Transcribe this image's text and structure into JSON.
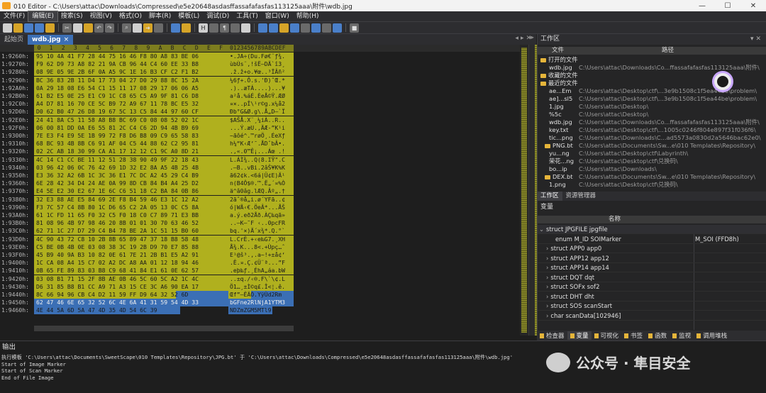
{
  "window": {
    "title": "010 Editor - C:\\Users\\attac\\Downloads\\Compressed\\e5e20648asdasffassafafasfas113125aaa\\附件\\wdb.jpg"
  },
  "menu": [
    "文件(F)",
    "编辑(E)",
    "搜索(S)",
    "视图(V)",
    "格式(O)",
    "脚本(R)",
    "模板(L)",
    "调试(D)",
    "工具(T)",
    "窗口(W)",
    "帮助(H)"
  ],
  "tabs": {
    "start": "起始页",
    "file": "wdb.jpg",
    "close": "×"
  },
  "hex": {
    "column_labels": [
      "0",
      "1",
      "2",
      "3",
      "4",
      "5",
      "6",
      "7",
      "8",
      "9",
      "A",
      "B",
      "C",
      "D",
      "E",
      "F"
    ],
    "ascii_header": "0123456789ABCDEF",
    "rows": [
      {
        "addr": "1:9260h:",
        "hex": "95 10 4A 41 F7 28 44 75 16 46 F8 80 A8 83 BE 06",
        "ascii": "•.JA÷(Du.Fø€¨ƒ¾."
      },
      {
        "addr": "1:9270h:",
        "hex": "F9 62 D9 73 A8 82 21 9A CB 96 44 C4 60 EE 33 B8",
        "ascii": "ùbÙs¨‚!šË–DÄ`î3¸"
      },
      {
        "addr": "1:9280h:",
        "hex": "08 9E 05 9E 2B 6F 0A A5 9C 1E 16 B3 CF C2 F1 B2",
        "ascii": ".ž.ž+o.¥œ..³ÏÂñ²"
      },
      {
        "addr": "1:9290h:",
        "hex": "BC 36 83 2B 11 D4 17 73 04 27 D0 29 88 8C 15 2A",
        "ascii": "¼6ƒ+.Ô.s.'Ð)ˆŒ.*"
      },
      {
        "addr": "1:92A0h:",
        "hex": "0A 29 18 08 E6 54 C1 15 11 17 08 29 17 06 06 A5",
        "ascii": ".)..æTÁ....)...¥"
      },
      {
        "addr": "1:92B0h:",
        "hex": "61 B2 E5 0E 25 E1 C9 1C C8 65 C5 A9 9F 81 C6 D8",
        "ascii": "a²å.%áÉ.ÈeÅ©Ÿ.ÆØ"
      },
      {
        "addr": "1:92C0h:",
        "hex": "A4 D7 81 16 70 CE 5C B9 72 A9 67 11 78 BC E5 32",
        "ascii": "¤×..pÎ\\¹r©g.x¼å2"
      },
      {
        "addr": "1:92D0h:",
        "hex": "D0 62 B0 47 26 D8 19 67 5C 13 C5 84 44 97 60 CF",
        "ascii": "Ðb°G&Ø.g\\.Å„D—`Ï"
      },
      {
        "addr": "1:92E0h:",
        "hex": "24 41 8A C5 11 58 A8 B8 BC 69 C0 08 08 52 02 1C",
        "ascii": "$AŠÅ.X¨¸¼iÀ..R.."
      },
      {
        "addr": "1:92F0h:",
        "hex": "06 00 81 DD 0A E6 55 81 2C C4 C6 2D 94 4B B9 69",
        "ascii": "...Ý.æU.,ÄÆ-”K¹i"
      },
      {
        "addr": "1:9300h:",
        "hex": "7E E3 F4 E9 5E 1B 99 72 F8 D6 B8 09 C9 65 58 83",
        "ascii": "~ãôé^.™røÖ¸.ÉeXƒ"
      },
      {
        "addr": "1:9310h:",
        "hex": "68 BC 93 4B 8B C6 91 AF 04 C5 44 88 62 C2 95 81",
        "ascii": "h¼“K‹Æ‘¯.ÅDˆbÂ•."
      },
      {
        "addr": "1:9320h:",
        "hex": "02 2C AB 18 30 99 CA A1 17 12 12 C1 9C A0 8D 21",
        "ascii": ".,«.0™Ê¡...Áœ .!"
      },
      {
        "addr": "1:9330h:",
        "hex": "4C 14 C1 CC BE 11 12 51 28 38 90 49 9F 22 18 43",
        "ascii": "L.ÁÌ¾..Q(8.IŸ\".C"
      },
      {
        "addr": "1:9340h:",
        "hex": "03 96 42 06 0C 76 42 69 1D 32 E2 8A A5 4B 25 4B",
        "ascii": ".–B..vBi.2âŠ¥K%K"
      },
      {
        "addr": "1:9350h:",
        "hex": "E3 36 32 A2 6B 1C 3C 36 E1 7C DC A2 45 29 C4 B9",
        "ascii": "ã62¢k.<6á|Ü¢E)Ä¹"
      },
      {
        "addr": "1:9360h:",
        "hex": "6E 28 42 34 D4 24 AE 0A 99 8D CB 84 B4 A4 25 D2",
        "ascii": "n(B4Ô$®.™.Ë„´¤%Ò"
      },
      {
        "addr": "1:9370h:",
        "hex": "E4 5E E2 30 E2 67 1E 6C C6 51 18 C2 BA 84 0B 86",
        "ascii": "ä^â0âg.lÆQ.Âº„.†"
      },
      {
        "addr": "1:9380h:",
        "hex": "32 E3 88 AE E5 84 69 2E F8 B4 59 46 E3 1C 12 A2",
        "ascii": "2ãˆ®å„i.ø´YFã..¢"
      },
      {
        "addr": "1:9390h:",
        "hex": "F3 7C 57 C4 8B 80 1C D6 65 C2 2A 05 13 0C C5 8A",
        "ascii": "ó|WÄ‹€.ÖeÂ*...ÅŠ"
      },
      {
        "addr": "1:93A0h:",
        "hex": "61 1C FD 11 65 F0 32 C5 F0 18 C0 C7 89 71 E3 BB",
        "ascii": "a.ý.eð2Åð.ÀÇ‰qã»"
      },
      {
        "addr": "1:93B0h:",
        "hex": "81 08 96 4B 97 98 46 20 8B 01 01 30 70 63 46 52",
        "ascii": "..–K—˜F ‹..0pcFR"
      },
      {
        "addr": "1:93C0h:",
        "hex": "62 71 1C 27 D7 29 C4 B4 78 BE 2A 1C 51 15 B0 60",
        "ascii": "bq.'×)Ä´x¾*.Q.°`"
      },
      {
        "addr": "1:93D0h:",
        "hex": "4C 90 43 72 C8 10 2B 8B 65 89 47 37 18 B8 58 48",
        "ascii": "L.CrÈ.+‹e‰G7.¸XH"
      },
      {
        "addr": "1:93E0h:",
        "hex": "C5 BE 0B 4B 0E 03 08 38 3C 19 2B D9 70 E7 85 88",
        "ascii": "Å¾.K...8<.+Ùpç…ˆ"
      },
      {
        "addr": "1:93F0h:",
        "hex": "45 B9 40 9A B3 10 82 0E 61 7E 21 2B B1 E5 A2 91",
        "ascii": "E¹@š³.‚.a~!+±å¢‘"
      },
      {
        "addr": "1:9400h:",
        "hex": "1C CA 08 A4 15 C7 02 A2 DC A8 AA 01 12 18 94 46",
        "ascii": ".Ê.¤.Ç.¢Ü¨ª...”F"
      },
      {
        "addr": "1:9410h:",
        "hex": "0B 65 FE 89 83 03 B8 C9 68 41 84 E1 61 0E 62 57",
        "ascii": ".eþ‰ƒ.¸ÉhA„áa.bW"
      },
      {
        "addr": "1:9420h:",
        "hex": "03 08 B1 71 15 2F 8B AE 0B 46 5C 60 5C A2 1C 4C",
        "ascii": "..±q./‹®.F\\`\\¢.L"
      },
      {
        "addr": "1:9430h:",
        "hex": "D6 31 85 B8 B1 CC A9 71 A3 15 CE 3C A6 90 EA 17",
        "ascii": "Ö1…¸±Ì©q£.Î<¦.ê."
      },
      {
        "addr": "1:9440h:",
        "hex": "8C 66 94 96 CB C4 D2 11 59 FF D9 64 32 52 6D",
        "ascii": "Œf”–ËÄÒ.YÿÙd2Rm"
      },
      {
        "addr": "1:9450h:",
        "hex": "62 47 46 6E 65 32 52 6C 4E 6A 41 31 59 54 4D 33",
        "ascii": "bGFne2RlNjA1YTM3"
      },
      {
        "addr": "1:9460h:",
        "hex": "4E 44 5A 6D 5A 47 4D 35 4D 54 6C 39",
        "ascii": "NDZmZGM5MTl9"
      }
    ]
  },
  "workspace": {
    "title": "工作区",
    "col_file": "文件",
    "col_path": "路径",
    "items": [
      {
        "indent": 0,
        "folder": true,
        "name": "打开的文件",
        "path": ""
      },
      {
        "indent": 2,
        "folder": false,
        "name": "wdb.jpg",
        "path": "C:\\Users\\attac\\Downloads\\Co...ffassafafasfas113125aaa\\附件\\"
      },
      {
        "indent": 0,
        "folder": true,
        "name": "收藏的文件",
        "path": ""
      },
      {
        "indent": 0,
        "folder": true,
        "name": "最近的文件",
        "path": ""
      },
      {
        "indent": 2,
        "folder": false,
        "name": "ae...Em",
        "path": "C:\\Users\\attac\\Desktop\\ctf\\...3e9b1508c1f5ea44be\\problem\\"
      },
      {
        "indent": 2,
        "folder": false,
        "name": "ae]...sl5",
        "path": "C:\\Users\\attac\\Desktop\\ctf\\...3e9b1508c1f5ea44be\\problem\\"
      },
      {
        "indent": 2,
        "folder": false,
        "name": "1.jpg",
        "path": "C:\\Users\\attac\\Desktop\\"
      },
      {
        "indent": 2,
        "folder": false,
        "name": "%5c",
        "path": "C:\\Users\\attac\\Desktop\\"
      },
      {
        "indent": 2,
        "folder": false,
        "name": "wdb.jpg",
        "path": "C:\\Users\\attac\\Downloads\\Co...ffassafafasfas113125aaa\\附件\\"
      },
      {
        "indent": 2,
        "folder": false,
        "name": "key.txt",
        "path": "C:\\Users\\attac\\Desktop\\ctf\\...1005c0246f804e897f31f036f6\\"
      },
      {
        "indent": 2,
        "folder": false,
        "name": "tic...png",
        "path": "C:\\Users\\attac\\Downloads\\C...ad5573a0830d2a5646bac62e0\\"
      },
      {
        "indent": 1,
        "folder": true,
        "name": "PNG.bt",
        "path": "C:\\Users\\attac\\Documents\\Sw...e\\010 Templates\\Repository\\"
      },
      {
        "indent": 2,
        "folder": false,
        "name": "yu...ng",
        "path": "C:\\Users\\attac\\Desktop\\ctf\\Labyrinth\\"
      },
      {
        "indent": 2,
        "folder": false,
        "name": "荣花...ng",
        "path": "C:\\Users\\attac\\Desktop\\ctf\\兑换码\\"
      },
      {
        "indent": 2,
        "folder": false,
        "name": "bo...ip",
        "path": "C:\\Users\\attac\\Downloads\\"
      },
      {
        "indent": 1,
        "folder": true,
        "name": "DEX.bt",
        "path": "C:\\Users\\attac\\Documents\\Sw...e\\010 Templates\\Repository\\"
      },
      {
        "indent": 2,
        "folder": false,
        "name": "1.png",
        "path": "C:\\Users\\attac\\Desktop\\ctf\\兑换码\\"
      }
    ],
    "tabs": [
      "工作区",
      "资源管理器"
    ]
  },
  "variables": {
    "title": "变量",
    "col_name": "名称",
    "items": [
      {
        "indent": 0,
        "name": "struct JPGFILE jpgfile",
        "value": "",
        "root": true,
        "arrow": "⌄"
      },
      {
        "indent": 2,
        "name": "enum M_ID SOIMarker",
        "value": "M_SOI (FFD8h)",
        "arrow": ""
      },
      {
        "indent": 1,
        "name": "struct APP0 app0",
        "value": "",
        "arrow": "›"
      },
      {
        "indent": 1,
        "name": "struct APP12 app12",
        "value": "",
        "arrow": "›"
      },
      {
        "indent": 1,
        "name": "struct APP14 app14",
        "value": "",
        "arrow": "›"
      },
      {
        "indent": 1,
        "name": "struct DQT dqt",
        "value": "",
        "arrow": "›"
      },
      {
        "indent": 1,
        "name": "struct SOFx sof2",
        "value": "",
        "arrow": "›"
      },
      {
        "indent": 1,
        "name": "struct DHT dht",
        "value": "",
        "arrow": "›"
      },
      {
        "indent": 1,
        "name": "struct SOS scanStart",
        "value": "",
        "arrow": "›"
      },
      {
        "indent": 1,
        "name": "char scanData[102946]",
        "value": "",
        "arrow": "›"
      }
    ]
  },
  "bottom_tabs": [
    "检查器",
    "变量",
    "可视化",
    "书签",
    "函数",
    "监视",
    "调用堆栈"
  ],
  "output": {
    "title": "输出",
    "lines": [
      "执行模板 'C:\\Users\\attac\\Documents\\SweetScape\\010 Templates\\Repository\\JPG.bt' 于 'C:\\Users\\attac\\Downloads\\Compressed\\e5e20648asdasffassafafasfas113125aaa\\附件\\wdb.jpg'",
      "Start of Image Marker",
      "Start of Scan Marker",
      "End of File Image"
    ]
  },
  "watermark": "公众号 · 隼目安全",
  "colors": {
    "hex_bg": "#b0b01e",
    "selection": "#3b6fb5",
    "panel": "#252526"
  }
}
